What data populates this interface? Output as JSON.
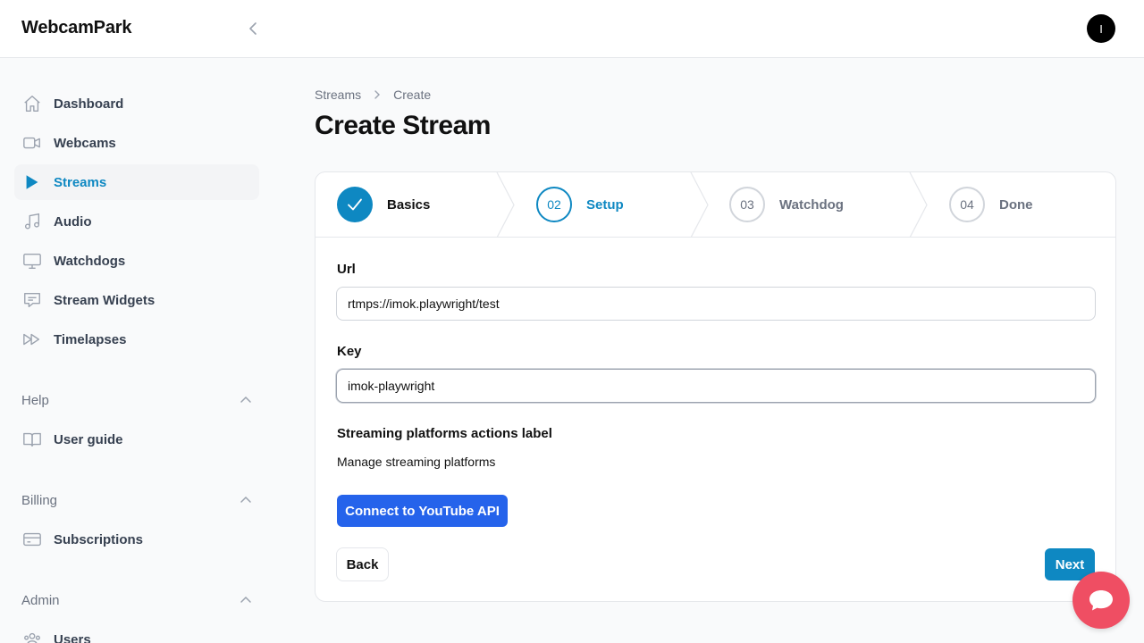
{
  "app": {
    "brand": "WebcamPark",
    "avatar_initial": "I"
  },
  "sidebar": {
    "items": [
      {
        "label": "Dashboard",
        "icon": "home-icon"
      },
      {
        "label": "Webcams",
        "icon": "video-camera-icon"
      },
      {
        "label": "Streams",
        "icon": "play-icon",
        "active": true
      },
      {
        "label": "Audio",
        "icon": "music-note-icon"
      },
      {
        "label": "Watchdogs",
        "icon": "monitor-icon"
      },
      {
        "label": "Stream Widgets",
        "icon": "chat-message-icon"
      },
      {
        "label": "Timelapses",
        "icon": "fast-forward-icon"
      }
    ],
    "sections": [
      {
        "title": "Help",
        "items": [
          {
            "label": "User guide",
            "icon": "book-icon"
          }
        ]
      },
      {
        "title": "Billing",
        "items": [
          {
            "label": "Subscriptions",
            "icon": "credit-card-icon"
          }
        ]
      },
      {
        "title": "Admin",
        "items": [
          {
            "label": "Users",
            "icon": "users-icon"
          }
        ]
      }
    ]
  },
  "breadcrumb": {
    "parent": "Streams",
    "current": "Create"
  },
  "page": {
    "title": "Create Stream"
  },
  "steps": [
    {
      "number": "",
      "label": "Basics",
      "state": "complete"
    },
    {
      "number": "02",
      "label": "Setup",
      "state": "current"
    },
    {
      "number": "03",
      "label": "Watchdog",
      "state": "upcoming"
    },
    {
      "number": "04",
      "label": "Done",
      "state": "upcoming"
    }
  ],
  "form": {
    "url": {
      "label": "Url",
      "value": "rtmps://imok.playwright/test"
    },
    "key": {
      "label": "Key",
      "value": "imok-playwright"
    },
    "platforms_label": "Streaming platforms actions label",
    "platforms_text": "Manage streaming platforms",
    "youtube_button": "Connect to YouTube API",
    "back_button": "Back",
    "next_button": "Next"
  },
  "colors": {
    "accent": "#0e88c2",
    "youtube_button": "#2563eb",
    "chat_bubble": "#ef4e63"
  }
}
